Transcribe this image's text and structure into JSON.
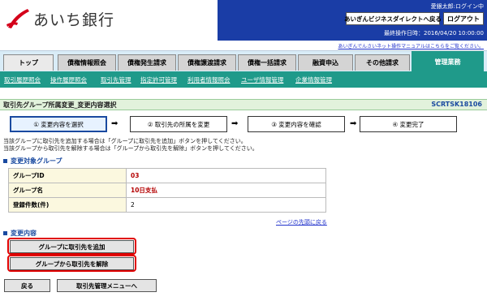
{
  "header": {
    "bank_name": "あいち銀行",
    "user": "愛銀太郎:ログイン中",
    "direct_button": "あいぎんビジネスダイレクトへ戻る",
    "logout_button": "ログアウト",
    "last_operation": "最終操作日時：2016/04/20 10:00:00",
    "manual_link": "あいぎんでんさいネット操作マニュアルはこちらをご覧ください。"
  },
  "tabs": [
    {
      "label": "トップ"
    },
    {
      "label": "債権情報照会"
    },
    {
      "label": "債権発生請求"
    },
    {
      "label": "債権譲渡請求"
    },
    {
      "label": "債権一括請求"
    },
    {
      "label": "融資申込"
    },
    {
      "label": "その他請求"
    },
    {
      "label": "管理業務",
      "active": true
    }
  ],
  "subnav": [
    {
      "label": "取引履歴照会"
    },
    {
      "label": "操作履歴照会"
    },
    {
      "label": "取引先管理"
    },
    {
      "label": "指定許可管理"
    },
    {
      "label": "利用者情報照会"
    },
    {
      "label": "ユーザ情報管理"
    },
    {
      "label": "企業情報管理"
    }
  ],
  "page": {
    "title": "取引先グループ所属変更_変更内容選択",
    "screen_code": "SCRTSK18106"
  },
  "steps": [
    {
      "label": "① 変更内容を選択",
      "current": true
    },
    {
      "label": "② 取引先の所属を変更"
    },
    {
      "label": "③ 変更内容を確認"
    },
    {
      "label": "④ 変更完了"
    }
  ],
  "notes": [
    "当該グループに取引先を追加する場合は「グループに取引先を追加」ボタンを押してください。",
    "当該グループから取引先を解除する場合は「グループから取引先を解除」ボタンを押してください。"
  ],
  "target_group": {
    "heading": "変更対象グループ",
    "rows": [
      {
        "label": "グループID",
        "value": "03"
      },
      {
        "label": "グループ名",
        "value": "10日支払"
      },
      {
        "label": "登録件数(件)",
        "value": "2"
      }
    ]
  },
  "page_top_link": "ページの先頭に戻る",
  "change_section": {
    "heading": "変更内容",
    "add_button": "グループに取引先を追加",
    "remove_button": "グループから取引先を解除"
  },
  "footer": {
    "back_button": "戻る",
    "menu_button": "取引先管理メニューへ"
  },
  "colors": {
    "header_blue": "#1a3da6",
    "tab_teal": "#1f9a8a",
    "highlight_red": "#e00000"
  }
}
